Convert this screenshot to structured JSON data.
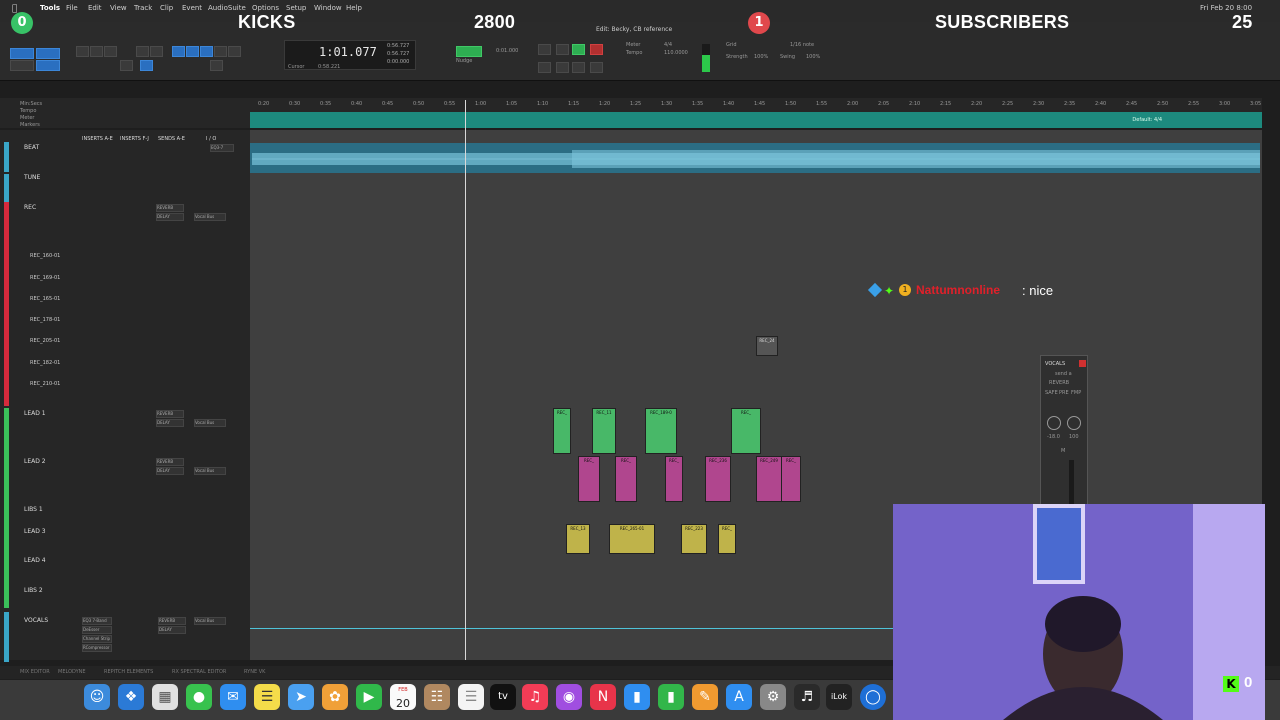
{
  "menubar": {
    "apple": "",
    "items": [
      "Tools",
      "File",
      "Edit",
      "View",
      "Track",
      "Clip",
      "Event",
      "AudioSuite",
      "Options",
      "Setup",
      "Window",
      "Help"
    ],
    "clock": "Fri Feb 20 8:00"
  },
  "overlay": {
    "kicks_count": "0",
    "kicks_label": "KICKS",
    "kicks_total": "2800",
    "subs_count": "1",
    "subs_label": "SUBSCRIBERS",
    "subs_total": "25",
    "kick_viewers": "0",
    "colors": {
      "green": "#38c267",
      "red": "#e0484c",
      "kick": "#53fc18"
    }
  },
  "window": {
    "title": "Edit: Becky, CB reference"
  },
  "transport": {
    "main_counter": "1:01.077",
    "sub_start": "0:56.727",
    "sub_end": "0:56.727",
    "sub_length": "0:00.000",
    "cursor_label": "Cursor",
    "cursor_value": "0:58.221",
    "nudge_value": "0:01.000",
    "nudge_label": "Nudge",
    "tempo_label": "Tempo",
    "tempo_value": "110.0000",
    "grid_label": "Grid",
    "grid_value": "1/16 note",
    "meter_label": "Meter",
    "meter_value": "4/4",
    "zoom_label": "Strength",
    "zoom_value": "100%",
    "swing_label": "Swing",
    "swing_value": "100%"
  },
  "rulers": {
    "left_labels": [
      "Min:Secs",
      "Tempo",
      "Meter",
      "Markers"
    ],
    "ticks": [
      "0:20",
      "0:30",
      "0:35",
      "0:40",
      "0:45",
      "0:50",
      "0:55",
      "1:00",
      "1:05",
      "1:10",
      "1:15",
      "1:20",
      "1:25",
      "1:30",
      "1:35",
      "1:40",
      "1:45",
      "1:50",
      "1:55",
      "2:00",
      "2:05",
      "2:10",
      "2:15",
      "2:20",
      "2:25",
      "2:30",
      "2:35",
      "2:40",
      "2:45",
      "2:50",
      "2:55",
      "3:00",
      "3:05"
    ],
    "marker_right": "Default: 4/4"
  },
  "mix_headers": [
    "INSERTS A-E",
    "INSERTS F-J",
    "SENDS A-E",
    "I / O"
  ],
  "tracks": [
    {
      "name": "BEAT",
      "color": "#3aa6c8",
      "inserts": [
        "EQ3-7",
        "Dyn3 C"
      ],
      "io": "Analog 1-2"
    },
    {
      "name": "TUNE",
      "color": "#3aa6c8",
      "inserts": [],
      "io": "Analog 1-2"
    },
    {
      "name": "REC",
      "color": "#d62a3c",
      "inserts": [],
      "sends": [
        "REVERB",
        "DELAY"
      ],
      "io": "Vocal Bus"
    },
    {
      "name": "LEAD 1",
      "color": "#3bbf5a",
      "inserts": [],
      "sends": [
        "REVERB",
        "DELAY"
      ],
      "io": "Vocal Bus"
    },
    {
      "name": "LEAD 2",
      "color": "#c04aa0",
      "inserts": [],
      "sends": [
        "REVERB",
        "DELAY"
      ],
      "io": "Vocal Bus"
    },
    {
      "name": "LIBS 1",
      "color": "#c8c040",
      "inserts": [],
      "sends": [],
      "io": "Vocal Bus"
    },
    {
      "name": "LEAD 3",
      "color": "#c8c040",
      "inserts": [],
      "sends": [],
      "io": "Vocal Bus"
    },
    {
      "name": "LEAD 4",
      "color": "#c8c040",
      "inserts": [],
      "sends": [],
      "io": "Vocal Bus"
    },
    {
      "name": "LIBS 2",
      "color": "#c8c040",
      "inserts": [],
      "sends": [],
      "io": "Vocal Bus"
    },
    {
      "name": "VOCALS",
      "color": "#3aa6c8",
      "inserts": [
        "EQ3 7-Band",
        "DeEsser",
        "Channel Strip",
        "RCompressor",
        "RVox"
      ],
      "sends": [
        "REVERB",
        "DELAY"
      ],
      "io": "Vocal Bus"
    }
  ],
  "playlists": [
    "REC_160-01",
    "REC_169-01",
    "REC_165-01",
    "REC_178-01",
    "REC_205-01",
    "REC_182-01",
    "REC_210-01"
  ],
  "clips": {
    "rec": [
      "REC_24"
    ],
    "lead1": [
      "REC_",
      "REC_11",
      "REC_189-0",
      "REC_"
    ],
    "lead2": [
      "REC_",
      "REC_",
      "REC_",
      "REC_236",
      "REC_249",
      "REC_"
    ],
    "libs": [
      "REC_13",
      "REC_265-01",
      "REC_223",
      "REC_"
    ]
  },
  "chat": {
    "username": "Nattumnonline",
    "message": ": nice"
  },
  "send_window": {
    "title": "VOCALS",
    "send": "send a",
    "bus": "REVERB",
    "buttons": [
      "SAFE",
      "PRE",
      "FMP"
    ],
    "vol": "-18.0",
    "pan": "100",
    "m": "M"
  },
  "statusbar": [
    "MIX EDITOR",
    "MELODYNE",
    "REPITCH ELEMENTS",
    "RX SPECTRAL EDITOR",
    "RYNE VK"
  ],
  "dock": {
    "calendar_month": "FEB",
    "calendar_day": "20",
    "tv": "tv"
  }
}
